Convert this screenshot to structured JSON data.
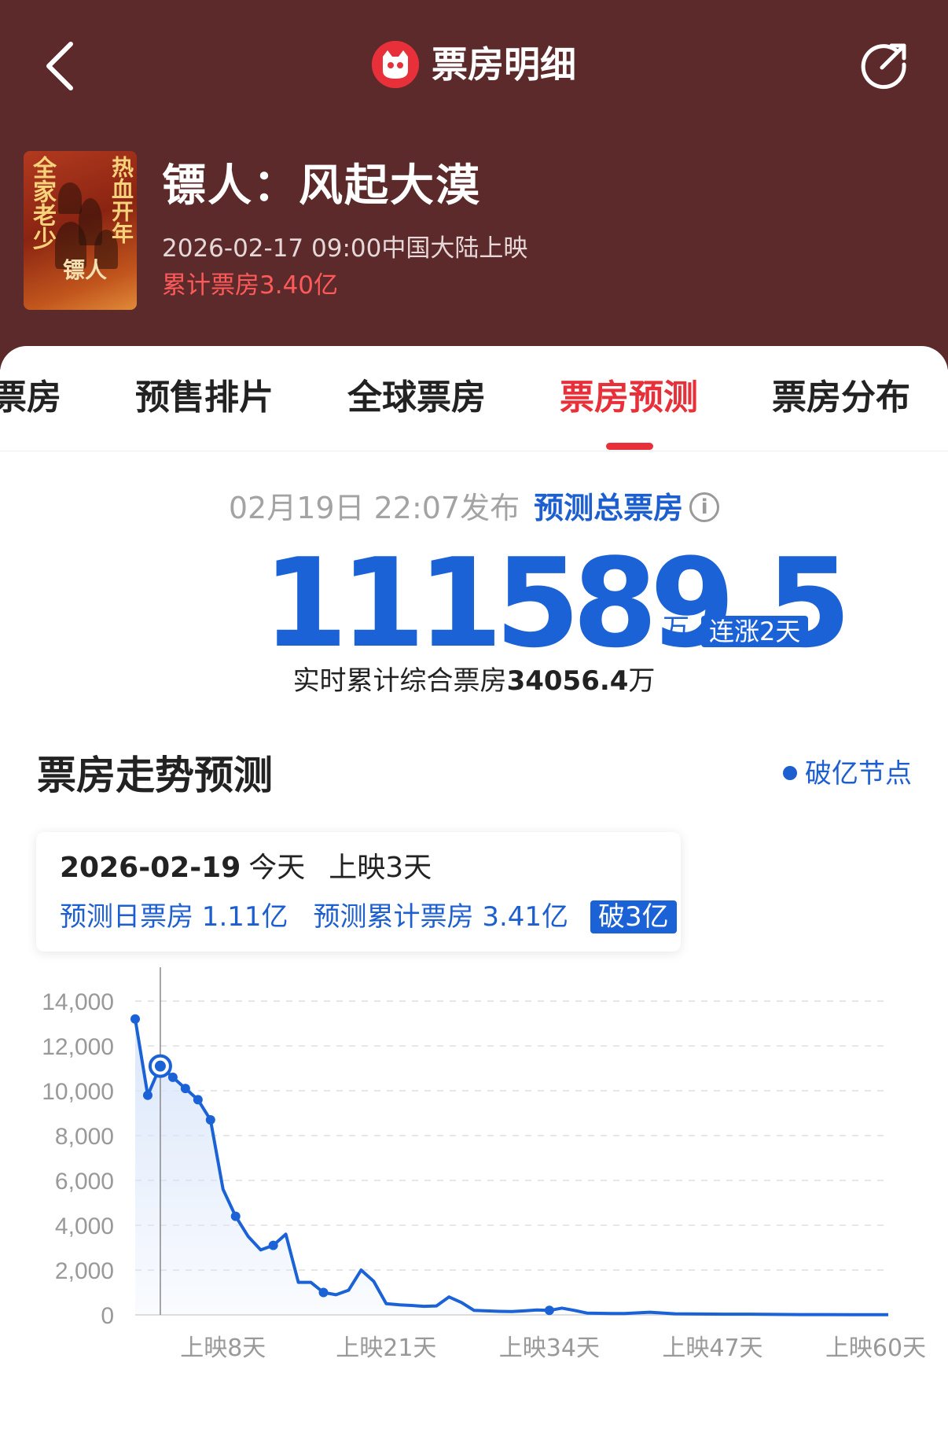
{
  "header": {
    "title": "票房明细",
    "back_icon": "chevron-left-icon",
    "share_icon": "share-icon",
    "bg_color": "#5c2a2a"
  },
  "movie": {
    "poster": {
      "line1": "全家老少",
      "line2": "热血开年",
      "line3": "镖人"
    },
    "title": "镖人：风起大漠",
    "release": "2026-02-17 09:00中国大陆上映",
    "total_box_office": "累计票房3.40亿"
  },
  "tabs": {
    "items": [
      {
        "label": "票房"
      },
      {
        "label": "预售排片"
      },
      {
        "label": "全球票房"
      },
      {
        "label": "票房预测"
      },
      {
        "label": "票房分布"
      }
    ],
    "active_index": 3,
    "active_color": "#e8303a"
  },
  "forecast": {
    "published": "02月19日 22:07发布",
    "label": "预测总票房",
    "info_icon": "info-icon",
    "value": "111589.5",
    "unit": "万",
    "streak": "连涨2天",
    "realtime_prefix": "实时累计综合票房",
    "realtime_value": "34056.4",
    "realtime_unit": "万",
    "accent_color": "#1b62d6"
  },
  "trend": {
    "title": "票房走势预测",
    "legend": "破亿节点",
    "tooltip": {
      "date": "2026-02-19",
      "today": "今天",
      "days": "上映3天",
      "daily": "预测日票房 1.11亿",
      "cumulative": "预测累计票房 3.41亿",
      "badge": "破3亿"
    }
  },
  "chart_data": {
    "type": "area",
    "title": "",
    "xlabel": "",
    "ylabel": "",
    "ylim": [
      0,
      14000
    ],
    "yticks": [
      "14,000",
      "12,000",
      "10,000",
      "8,000",
      "6,000",
      "4,000",
      "2,000",
      "0"
    ],
    "xticks": [
      "上映8天",
      "上映21天",
      "上映34天",
      "上映47天",
      "上映60天"
    ],
    "xtick_days": [
      8,
      21,
      34,
      47,
      60
    ],
    "xlim": [
      1,
      61
    ],
    "grid": true,
    "series": [
      {
        "days": [
          1,
          2,
          3,
          4,
          5,
          6,
          7,
          8,
          9,
          10,
          11,
          12,
          13,
          14,
          15,
          16,
          17,
          18,
          19,
          20,
          21,
          22,
          23,
          24,
          25,
          26,
          27,
          28,
          29,
          30,
          31,
          32,
          33,
          34,
          35,
          36,
          37,
          38,
          39,
          40,
          42,
          44,
          46,
          48,
          50,
          52,
          54,
          56,
          58,
          61
        ],
        "values": [
          13200,
          9800,
          11100,
          10600,
          10100,
          9600,
          8700,
          5600,
          4400,
          3500,
          2900,
          3100,
          3600,
          1450,
          1450,
          1000,
          900,
          1100,
          2000,
          1500,
          500,
          450,
          420,
          380,
          400,
          800,
          550,
          200,
          180,
          160,
          150,
          180,
          220,
          200,
          300,
          200,
          80,
          70,
          60,
          60,
          120,
          50,
          40,
          30,
          30,
          20,
          15,
          12,
          10,
          10
        ]
      }
    ],
    "markers": [
      1,
      2,
      3,
      4,
      5,
      6,
      7,
      9,
      12,
      16,
      34
    ],
    "highlight_day": 3,
    "line_color": "#1b62d6",
    "fill_color": "#dbe7fb"
  }
}
